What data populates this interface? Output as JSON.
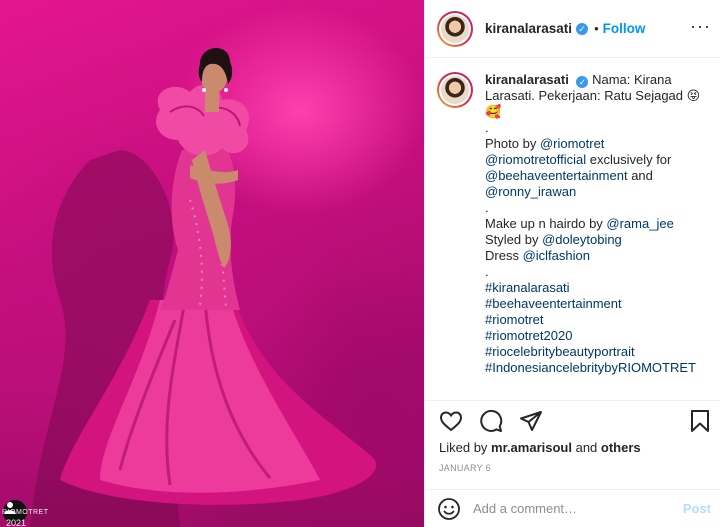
{
  "post": {
    "username": "kiranalarasati",
    "verified_icon": "verified-badge-icon",
    "separator": "•",
    "follow_label": "Follow",
    "more_icon": "more-options-icon"
  },
  "photo": {
    "watermark_text": "RIOMOTRET",
    "watermark_year": "2021"
  },
  "caption": {
    "author": "kiranalarasati",
    "intro": "Nama: Kirana",
    "line1": "Larasati. Pekerjaan: Ratu Sejagad 😝",
    "emoji_line": "🥰",
    "dot1": ".",
    "photo_by_prefix": "Photo by ",
    "photo_by_handle": "@riomotret",
    "riomotret_official": "@riomotretofficial",
    "exclusively_for": " exclusively for",
    "beehave": "@beehaveentertainment",
    "and": " and",
    "ronny": "@ronny_irawan",
    "dot2": ".",
    "makeup_prefix": "Make up n hairdo by ",
    "makeup_handle": "@rama_jee",
    "styled_prefix": "Styled by ",
    "styled_handle": "@doleytobing",
    "dress_prefix": "Dress ",
    "dress_handle": "@iclfashion",
    "dot3": ".",
    "hashtags": [
      "#kiranalarasati",
      "#beehaveentertainment",
      "#riomotret",
      "#riomotret2020",
      "#riocelebritybeautyportrait",
      "#IndonesiancelebritybyRIOMOTRET"
    ]
  },
  "actions": {
    "like_icon": "heart-icon",
    "comment_icon": "comment-icon",
    "share_icon": "paper-plane-icon",
    "save_icon": "bookmark-icon"
  },
  "likes": {
    "prefix": "Liked by ",
    "user": "mr.amarisoul",
    "middle": " and ",
    "others": "others"
  },
  "date": "JANUARY 6",
  "comment": {
    "emoji_icon": "smiley-icon",
    "placeholder": "Add a comment…",
    "post_label": "Post"
  },
  "colors": {
    "accent": "#0095f6",
    "post_disabled": "#b2dffc",
    "photo_background": "#d3128a"
  }
}
